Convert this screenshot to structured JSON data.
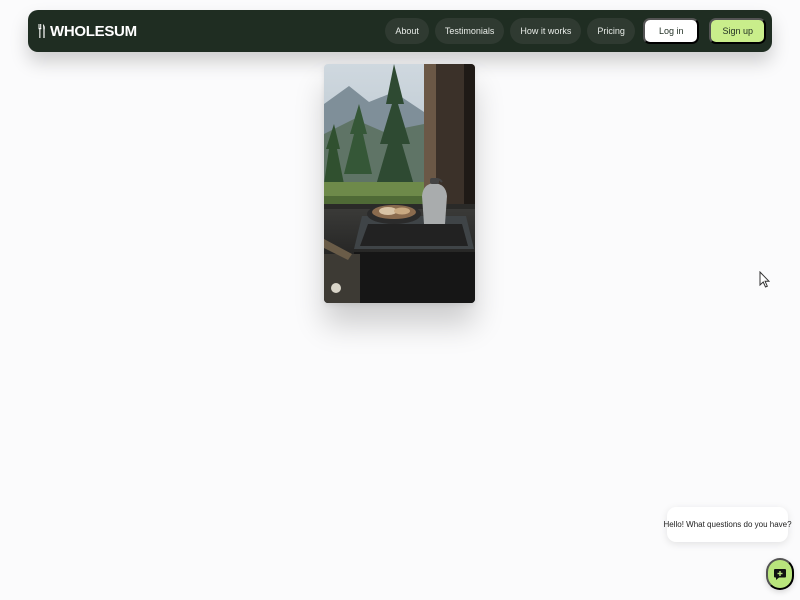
{
  "brand": {
    "name": "WHOLESUM",
    "logo_icon": "fork-knife-icon"
  },
  "nav": {
    "links": [
      "About",
      "Testimonials",
      "How it works",
      "Pricing"
    ],
    "login_label": "Log in",
    "signup_label": "Sign up"
  },
  "hero": {
    "image_description": "",
    "image_icon": "kitchen-photo"
  },
  "chat": {
    "greeting": "Hello! What questions do you have?",
    "launcher_icon": "chat-icon"
  },
  "colors": {
    "nav_background": "#1f2d22",
    "nav_pill": "#2f3a31",
    "signup_accent": "#c9ee8b",
    "chat_launcher": "#b9e57c",
    "page_background": "#fbfbfc"
  }
}
